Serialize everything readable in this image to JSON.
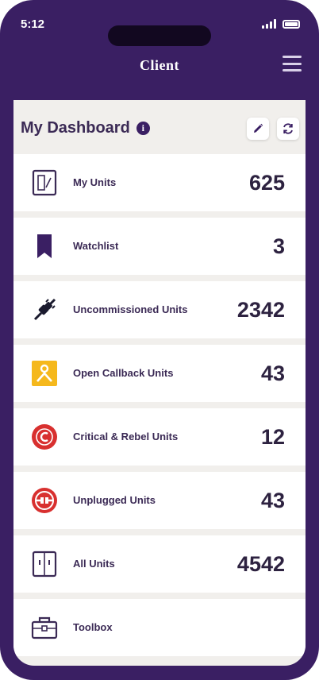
{
  "status_bar": {
    "time": "5:12"
  },
  "app_bar": {
    "title": "Client"
  },
  "dashboard": {
    "title": "My Dashboard"
  },
  "items": [
    {
      "label": "My Units",
      "count": "625",
      "icon": "units-icon",
      "color": "#3b2a55"
    },
    {
      "label": "Watchlist",
      "count": "3",
      "icon": "bookmark-icon",
      "color": "#3a1f63"
    },
    {
      "label": "Uncommissioned Units",
      "count": "2342",
      "icon": "plug-icon",
      "color": "#1a1a2e"
    },
    {
      "label": "Open Callback Units",
      "count": "43",
      "icon": "callback-icon",
      "color": "#f5b81c"
    },
    {
      "label": "Critical & Rebel Units",
      "count": "12",
      "icon": "critical-icon",
      "color": "#d8302f"
    },
    {
      "label": "Unplugged Units",
      "count": "43",
      "icon": "unplugged-icon",
      "color": "#d8302f"
    },
    {
      "label": "All Units",
      "count": "4542",
      "icon": "all-units-icon",
      "color": "#3b2a55"
    },
    {
      "label": "Toolbox",
      "count": "",
      "icon": "toolbox-icon",
      "color": "#3b2a55"
    }
  ],
  "colors": {
    "brand": "#3a1f63",
    "background": "#f1efec",
    "alert": "#d8302f",
    "warning": "#f5b81c"
  }
}
